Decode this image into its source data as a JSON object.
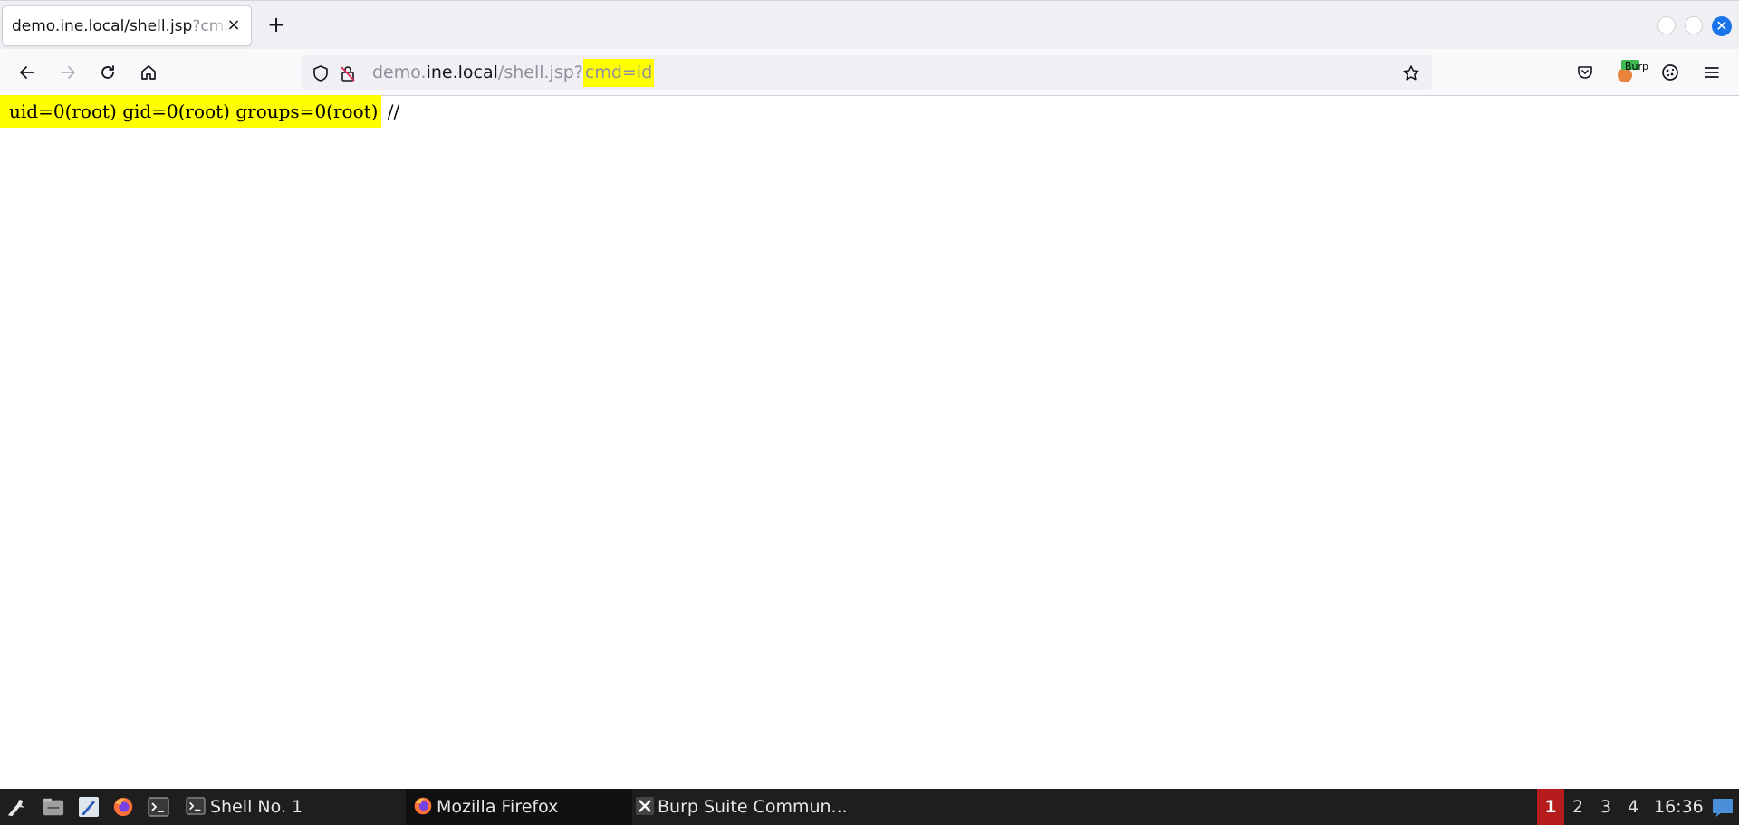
{
  "browser": {
    "tab": {
      "title_main": "demo.ine.local/shell.jsp",
      "title_dim": "?cmd=id",
      "close_glyph": "×"
    },
    "newtab_glyph": "+",
    "address": {
      "scheme_host_pre": "demo.",
      "host": "ine.local",
      "path": "/shell.jsp?",
      "highlight": "cmd=id"
    },
    "extension_badge": "Burp"
  },
  "page": {
    "output_highlight": "uid=0(root) gid=0(root) groups=0(root)",
    "output_tail": " //"
  },
  "taskbar": {
    "tasks": [
      {
        "label": "Shell No. 1",
        "icon": "terminal-icon"
      },
      {
        "label": "Mozilla Firefox",
        "icon": "firefox-icon"
      },
      {
        "label": "Burp Suite Commun...",
        "icon": "burp-icon"
      }
    ],
    "workspaces": [
      "1",
      "2",
      "3",
      "4"
    ],
    "active_workspace": "1",
    "clock": "16:36"
  },
  "colors": {
    "highlight": "#ffff00",
    "taskbar_bg": "#1e1e1e",
    "active_workspace": "#b71c1c",
    "close_button": "#1a73e8"
  }
}
